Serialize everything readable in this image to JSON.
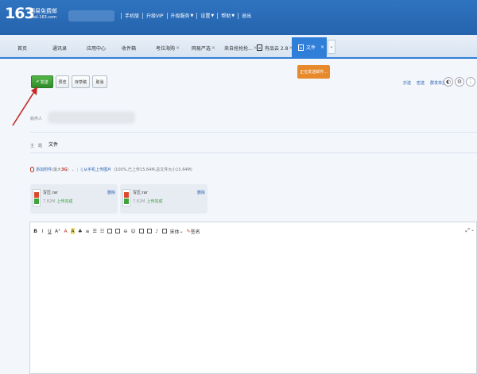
{
  "header": {
    "logo_num": "163",
    "logo_name": "网易免费邮",
    "logo_domain": "mail.163.com",
    "nav": [
      {
        "label": "手机版",
        "caret": false
      },
      {
        "label": "升级VIP",
        "caret": false
      },
      {
        "label": "升级服务",
        "caret": true
      },
      {
        "label": "设置",
        "caret": true
      },
      {
        "label": "帮助",
        "caret": true
      },
      {
        "label": "退出",
        "caret": false
      }
    ]
  },
  "tabs": [
    {
      "label": "首页"
    },
    {
      "label": "通讯录"
    },
    {
      "label": "应用中心"
    },
    {
      "label": "收件箱"
    },
    {
      "label": "考拉海购",
      "close": "×"
    },
    {
      "label": "网易严选",
      "close": "×"
    },
    {
      "label": "来自抢抢抢...",
      "close": "×"
    },
    {
      "label": "有品云 2.8",
      "close": "×"
    },
    {
      "label": "文件",
      "close": "×",
      "active": true
    }
  ],
  "tab_more": "⌄",
  "toolbar": {
    "send": "发送",
    "preview": "预览",
    "save_draft": "存草稿",
    "cancel": "取消"
  },
  "tooltip": "正在发送邮件...",
  "right_links": [
    "抄送",
    "密送",
    "群发单显"
  ],
  "form": {
    "recipient_label": "收件人",
    "subject_label": "主　题",
    "subject_value": "文件"
  },
  "attach_bar": {
    "add": "添加附件",
    "max_prefix": "(最大",
    "max_value": "3G",
    "max_suffix": ")",
    "from_phone": "从手机上传图片",
    "progress_text": "(100%,已上传15.64M,总文件大小15.64M)"
  },
  "files": [
    {
      "name": "写压.rar",
      "size": "7.82M",
      "status": "上传完成",
      "delete": "删除"
    },
    {
      "name": "写压.rar",
      "size": "7.82M",
      "status": "上传完成",
      "delete": "删除"
    }
  ],
  "editor": {
    "bold": "B",
    "italic": "I",
    "underline": "U",
    "fontsize": "A°",
    "color": "A",
    "highlight": "A",
    "font": "宋体",
    "signature": "签名",
    "expand": "⤢"
  }
}
